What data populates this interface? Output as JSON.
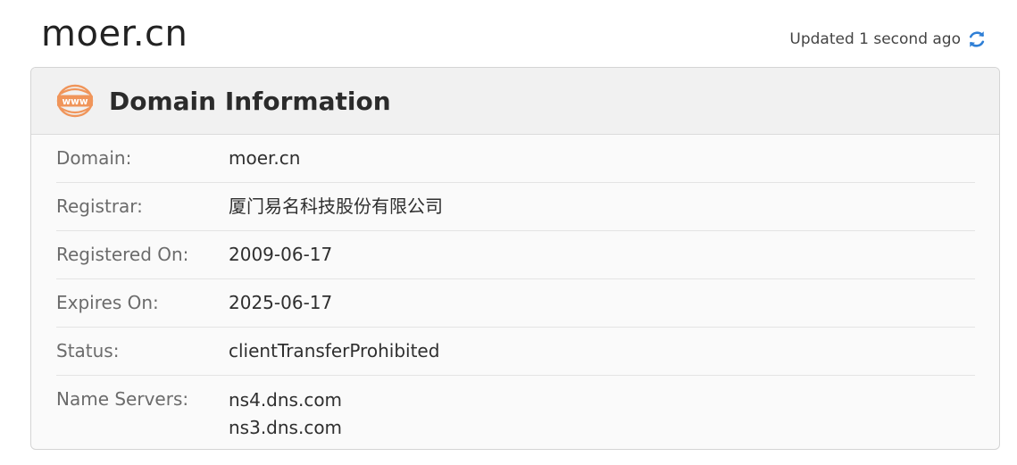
{
  "header": {
    "site_title": "moer.cn",
    "updated_text": "Updated 1 second ago",
    "refresh_icon": "refresh-icon"
  },
  "card": {
    "icon": "www-icon",
    "icon_text": "www",
    "title": "Domain Information",
    "accent_color": "#f0955a",
    "rows": [
      {
        "label": "Domain:",
        "value": "moer.cn"
      },
      {
        "label": "Registrar:",
        "value": "厦门易名科技股份有限公司"
      },
      {
        "label": "Registered On:",
        "value": "2009-06-17"
      },
      {
        "label": "Expires On:",
        "value": "2025-06-17"
      },
      {
        "label": "Status:",
        "value": "clientTransferProhibited"
      }
    ],
    "name_servers": {
      "label": "Name Servers:",
      "values": [
        "ns4.dns.com",
        "ns3.dns.com"
      ]
    }
  },
  "colors": {
    "refresh_icon": "#2f7fd6",
    "header_bg": "#f1f1f1"
  }
}
